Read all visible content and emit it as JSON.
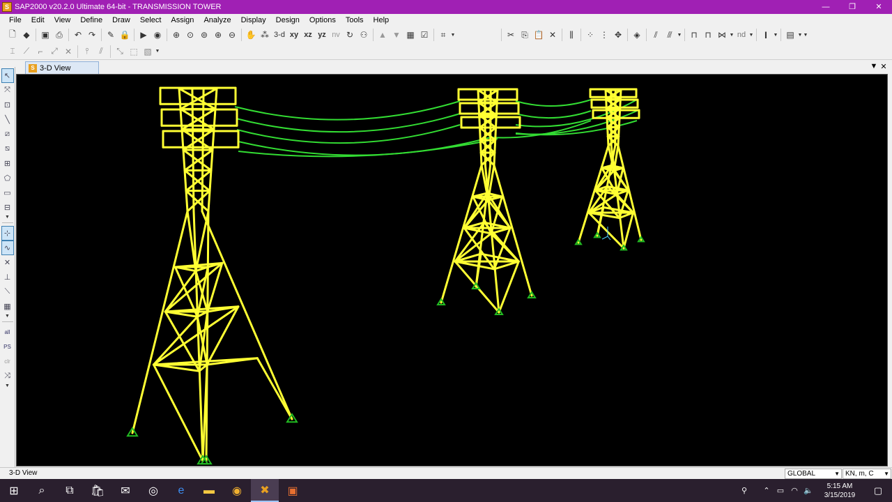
{
  "window": {
    "title": "SAP2000 v20.2.0 Ultimate 64-bit - TRANSMISSION TOWER",
    "app_icon": "sap-logo-icon",
    "minimize": "—",
    "maximize": "❐",
    "close": "✕"
  },
  "menu": [
    "File",
    "Edit",
    "View",
    "Define",
    "Draw",
    "Select",
    "Assign",
    "Analyze",
    "Display",
    "Design",
    "Options",
    "Tools",
    "Help"
  ],
  "toolbar": {
    "view_3d": "3-d",
    "view_xy": "xy",
    "view_xz": "xz",
    "view_yz": "yz",
    "view_nv": "nv",
    "nd": "nd",
    "section_i": "I"
  },
  "tab": {
    "label": "3-D View",
    "menu_arrow": "▼",
    "close": "✕"
  },
  "lefttools_text": {
    "all": "all",
    "ps": "PS",
    "clr": "clr"
  },
  "status": {
    "left": "3-D View",
    "coord_system": "GLOBAL",
    "units": "KN, m, C"
  },
  "tray": {
    "time": "5:15 AM",
    "date": "3/15/2019"
  },
  "colors": {
    "titlebar": "#a020b4",
    "frame": "#ffff33",
    "cable": "#33dd33",
    "support": "#22bb22",
    "viewport_bg": "#000000"
  }
}
